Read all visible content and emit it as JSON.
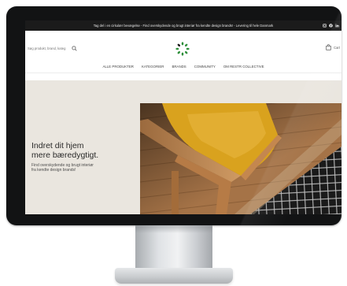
{
  "topbar": {
    "announcement": "Tag del i en cirkulær bevægelse - Find overskydende og brugt interiør fra kendte design brands! - Levering til hele Danmark",
    "social_icons": [
      "instagram-icon",
      "facebook-icon",
      "linkedin-icon"
    ]
  },
  "header": {
    "search_placeholder": "Søg produkt, brand, kateg",
    "search_icon": "search-icon",
    "logo_icon": "circular-leaf-logo",
    "cart_label": "Cart",
    "cart_icon": "shopping-bag-icon"
  },
  "nav": {
    "items": [
      "ALLE PRODUKTER",
      "KATEGORIER",
      "BRANDS",
      "COMMUNITY",
      "OM RESTR COLLECTIVE"
    ]
  },
  "hero": {
    "title_line1": "Indret dit hjem",
    "title_line2": "mere bæredygtigt.",
    "subtitle_line1": "Find overskydende og brugt interiør",
    "subtitle_line2": "fra kendte design brands!"
  },
  "colors": {
    "bezel": "#121314",
    "topbar": "#1b1b1b",
    "hero_bg": "#eae6df",
    "logo_green": "#2f8f3b",
    "chair_yellow": "#d9a21e",
    "wood": "#c9935c"
  }
}
